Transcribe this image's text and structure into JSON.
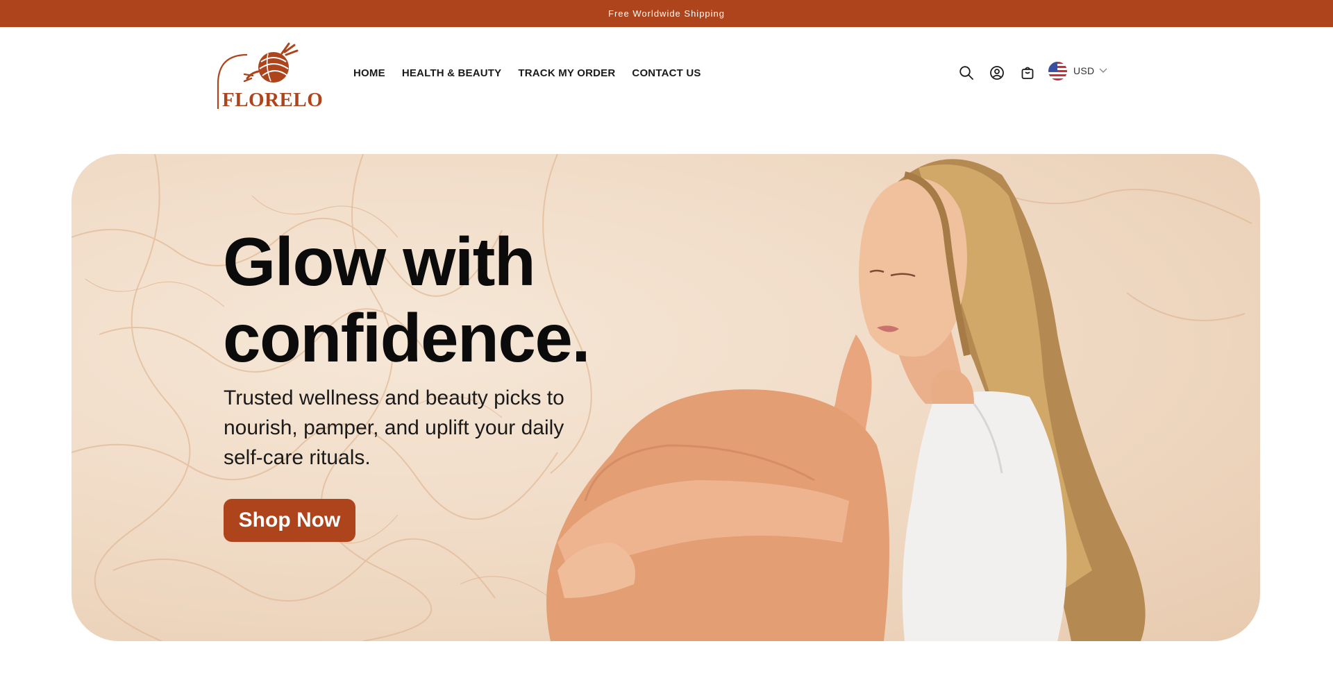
{
  "announcement": {
    "text": "Free Worldwide Shipping"
  },
  "brand": {
    "name": "FLORELO",
    "color": "#ad441c"
  },
  "nav": {
    "items": [
      {
        "label": "HOME"
      },
      {
        "label": "HEALTH & BEAUTY"
      },
      {
        "label": "TRACK MY ORDER"
      },
      {
        "label": "CONTACT US"
      }
    ]
  },
  "header_icons": {
    "search": "search-icon",
    "account": "account-icon",
    "cart": "cart-icon"
  },
  "currency": {
    "code": "USD",
    "flag": "us-flag-icon"
  },
  "hero": {
    "title_line1": "Glow with",
    "title_line2": "confidence.",
    "subtitle": "Trusted wellness and beauty picks to nourish, pamper, and uplift your daily self-care rituals.",
    "cta_label": "Shop Now",
    "cta_color": "#ad441c",
    "background_tone": "#efd9c3"
  }
}
